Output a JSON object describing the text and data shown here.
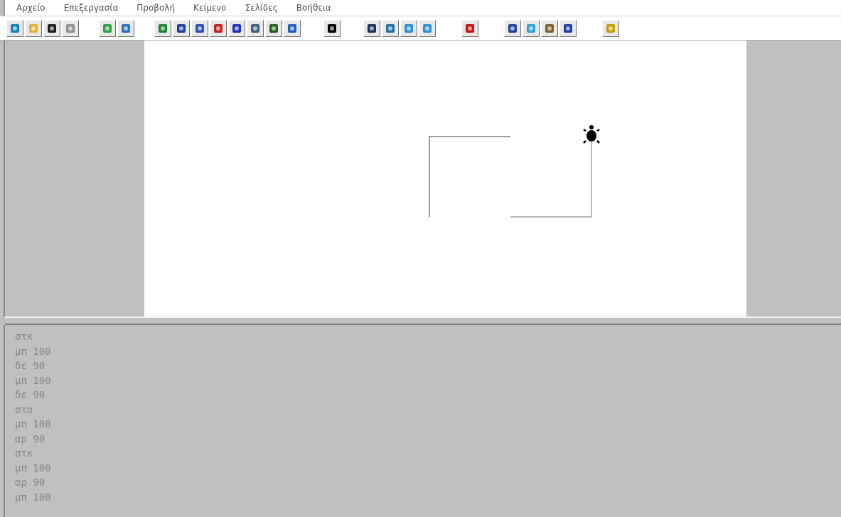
{
  "menu": [
    "Αρχείο",
    "Επεξεργασία",
    "Προβολή",
    "Κείμενο",
    "Σελίδες",
    "Βοήθεια"
  ],
  "commands": [
    "στκ",
    "μπ 100",
    "δε 90",
    "μπ 100",
    "δε 90",
    "στα",
    "μπ 100",
    "αρ 90",
    "στκ",
    "μπ 100",
    "αρ 90",
    "μπ 100"
  ]
}
